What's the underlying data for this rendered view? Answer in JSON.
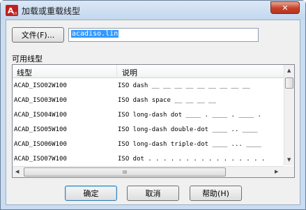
{
  "window": {
    "title": "加载或重载线型",
    "app_icon_text": "A",
    "app_icon_sub": "10",
    "close_glyph": "✕"
  },
  "file": {
    "button_label": "文件(F)...",
    "path": "acadiso.lin"
  },
  "linetypes": {
    "group_label": "可用线型",
    "columns": [
      "线型",
      "说明"
    ],
    "rows": [
      {
        "name": "ACAD_ISO02W100",
        "desc": "ISO dash __ __ __ __ __ __ __ __ __"
      },
      {
        "name": "ACAD_ISO03W100",
        "desc": "ISO dash space __    __    __    __"
      },
      {
        "name": "ACAD_ISO04W100",
        "desc": "ISO long-dash dot ____ . ____ . ____ ."
      },
      {
        "name": "ACAD_ISO05W100",
        "desc": "ISO long-dash double-dot ____ .. ____"
      },
      {
        "name": "ACAD_ISO06W100",
        "desc": "ISO long-dash triple-dot ____ ... ____"
      },
      {
        "name": "ACAD_ISO07W100",
        "desc": "ISO dot . . . . . . . . . . . . . . . ."
      }
    ],
    "scroll_grip": "III",
    "arrows": {
      "up": "▲",
      "down": "▼",
      "left": "◀",
      "right": "▶"
    }
  },
  "buttons": {
    "ok": "确定",
    "cancel": "取消",
    "help": "帮助(H)"
  },
  "colors": {
    "selection": "#3399ff",
    "close": "#c5412a",
    "icon_red": "#c0201e"
  }
}
